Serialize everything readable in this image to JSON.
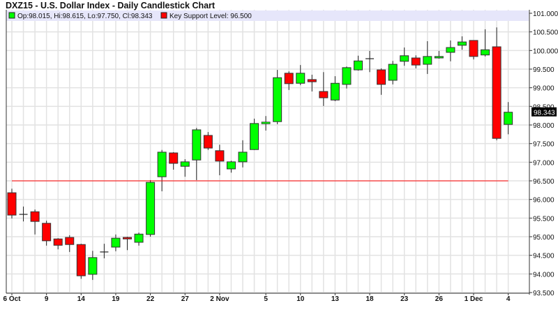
{
  "chart_data": {
    "type": "candlestick",
    "title": "DXZ15 - U.S. Dollar Index - Daily Candlestick Chart",
    "legend": {
      "ohlc_label": "Op:98.015, Hi:98.615, Lo:97.750, Cl:98.343",
      "support_label": "Key Support Level: 96.500",
      "placement": "top-left"
    },
    "colors": {
      "up": "#00ff00",
      "down": "#ff0000",
      "support": "#ff0000",
      "grid": "#e2e2e2",
      "legend_bg": "#e6e6fa"
    },
    "ylim": [
      93.5,
      101.0
    ],
    "yticks": [
      "101.000",
      "100.500",
      "100.000",
      "99.500",
      "99.000",
      "98.500",
      "98.000",
      "97.500",
      "97.000",
      "96.500",
      "96.000",
      "95.500",
      "95.000",
      "94.500",
      "94.000",
      "93.500"
    ],
    "ytick_values": [
      101.0,
      100.5,
      100.0,
      99.5,
      99.0,
      98.5,
      98.0,
      97.5,
      97.0,
      96.5,
      96.0,
      95.5,
      95.0,
      94.5,
      94.0,
      93.5
    ],
    "xticks": [
      {
        "label": "6 Oct",
        "index": 0
      },
      {
        "label": "9",
        "index": 3
      },
      {
        "label": "14",
        "index": 6
      },
      {
        "label": "19",
        "index": 9
      },
      {
        "label": "22",
        "index": 12
      },
      {
        "label": "27",
        "index": 15
      },
      {
        "label": "2 Nov",
        "index": 18
      },
      {
        "label": "5",
        "index": 22
      },
      {
        "label": "10",
        "index": 25
      },
      {
        "label": "13",
        "index": 28
      },
      {
        "label": "18",
        "index": 31
      },
      {
        "label": "23",
        "index": 34
      },
      {
        "label": "26",
        "index": 37
      },
      {
        "label": "1 Dec",
        "index": 40
      },
      {
        "label": "4",
        "index": 43
      }
    ],
    "support_level": 96.5,
    "last_price_label": "98.343",
    "last_price": 98.343,
    "ohlc": [
      [
        96.18,
        96.29,
        95.49,
        95.58
      ],
      [
        95.6,
        95.81,
        95.41,
        95.6
      ],
      [
        95.67,
        95.73,
        95.06,
        95.41
      ],
      [
        95.36,
        95.43,
        94.76,
        94.89
      ],
      [
        94.94,
        94.96,
        94.66,
        94.77
      ],
      [
        94.98,
        95.04,
        94.59,
        94.79
      ],
      [
        94.79,
        94.81,
        93.87,
        93.95
      ],
      [
        93.99,
        94.62,
        93.84,
        94.44
      ],
      [
        94.59,
        94.81,
        94.42,
        94.59
      ],
      [
        94.72,
        95.06,
        94.61,
        94.96
      ],
      [
        94.98,
        95.0,
        94.64,
        94.94
      ],
      [
        94.85,
        95.11,
        94.76,
        95.07
      ],
      [
        95.06,
        96.52,
        95.0,
        96.46
      ],
      [
        96.61,
        97.33,
        96.22,
        97.27
      ],
      [
        97.25,
        97.27,
        96.8,
        96.97
      ],
      [
        96.89,
        97.08,
        96.61,
        97.01
      ],
      [
        97.06,
        97.92,
        96.52,
        97.87
      ],
      [
        97.72,
        97.81,
        97.33,
        97.38
      ],
      [
        97.31,
        97.47,
        96.65,
        97.03
      ],
      [
        96.82,
        97.04,
        96.72,
        97.01
      ],
      [
        97.01,
        97.59,
        96.86,
        97.27
      ],
      [
        97.34,
        98.17,
        97.33,
        98.04
      ],
      [
        98.04,
        98.24,
        97.85,
        98.06
      ],
      [
        98.09,
        99.48,
        98.02,
        99.27
      ],
      [
        99.39,
        99.44,
        98.94,
        99.11
      ],
      [
        99.12,
        99.61,
        99.07,
        99.39
      ],
      [
        99.22,
        99.35,
        98.9,
        99.16
      ],
      [
        98.9,
        99.42,
        98.51,
        98.73
      ],
      [
        98.67,
        99.31,
        98.64,
        99.12
      ],
      [
        99.09,
        99.57,
        98.98,
        99.54
      ],
      [
        99.48,
        99.86,
        99.46,
        99.72
      ],
      [
        99.78,
        99.99,
        99.42,
        99.78
      ],
      [
        99.48,
        99.52,
        98.81,
        99.09
      ],
      [
        99.2,
        99.72,
        99.09,
        99.63
      ],
      [
        99.71,
        100.08,
        99.59,
        99.86
      ],
      [
        99.8,
        99.87,
        99.52,
        99.61
      ],
      [
        99.63,
        100.25,
        99.37,
        99.84
      ],
      [
        99.8,
        99.99,
        99.78,
        99.84
      ],
      [
        99.95,
        100.27,
        99.71,
        100.08
      ],
      [
        100.14,
        100.38,
        100.02,
        100.23
      ],
      [
        100.27,
        100.27,
        99.76,
        99.84
      ],
      [
        99.88,
        100.57,
        99.84,
        100.02
      ],
      [
        100.1,
        100.62,
        97.59,
        97.64
      ],
      [
        98.015,
        98.615,
        97.75,
        98.343
      ]
    ]
  }
}
